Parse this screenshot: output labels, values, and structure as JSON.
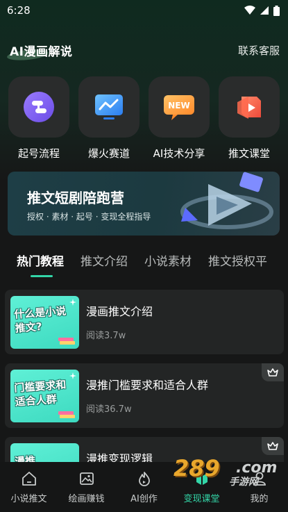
{
  "status_bar": {
    "time": "6:28"
  },
  "header": {
    "title": "AI漫画解说",
    "contact_label": "联系客服"
  },
  "shortcuts": [
    {
      "label": "起号流程",
      "icon": "flow-icon"
    },
    {
      "label": "爆火赛道",
      "icon": "trend-chart-icon"
    },
    {
      "label": "AI技术分享",
      "icon": "new-badge-icon",
      "badge_text": "NEW"
    },
    {
      "label": "推文课堂",
      "icon": "play-box-icon"
    }
  ],
  "banner": {
    "title": "推文短剧陪跑营",
    "subtitle": "授权 · 素材 · 起号 · 变现全程指导"
  },
  "tabs": [
    {
      "label": "热门教程",
      "active": true
    },
    {
      "label": "推文介绍"
    },
    {
      "label": "小说素材"
    },
    {
      "label": "推文授权平"
    }
  ],
  "articles": [
    {
      "title": "漫画推文介绍",
      "reads": "阅读3.7w",
      "thumb_text": "什么是小说推文?",
      "premium": false
    },
    {
      "title": "漫推门槛要求和适合人群",
      "reads": "阅读36.7w",
      "thumb_text": "门槛要求和适合人群",
      "premium": true
    },
    {
      "title": "漫推变现逻辑",
      "reads": "",
      "thumb_text": "漫推",
      "premium": true
    }
  ],
  "nav": [
    {
      "label": "小说推文",
      "icon": "home-icon"
    },
    {
      "label": "绘画赚钱",
      "icon": "image-icon"
    },
    {
      "label": "AI创作",
      "icon": "flame-icon"
    },
    {
      "label": "变现课堂",
      "icon": "book-icon",
      "active": true
    },
    {
      "label": "我的",
      "icon": "user-icon"
    }
  ],
  "watermark": {
    "number": "289",
    "suffix": ".com",
    "text": "手游网"
  },
  "colors": {
    "accent": "#33d6a8",
    "background": "#161717",
    "card": "#232525"
  }
}
